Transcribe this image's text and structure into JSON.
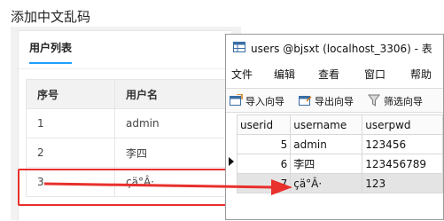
{
  "web": {
    "page_title": "添加中文乱码",
    "tab_label": "用户列表",
    "table": {
      "headers": [
        "序号",
        "用户名"
      ],
      "rows": [
        [
          "1",
          "admin"
        ],
        [
          "2",
          "李四"
        ],
        [
          "3",
          "çä°Â·"
        ]
      ]
    }
  },
  "window": {
    "title": "users @bjsxt (localhost_3306) - 表",
    "menu": [
      "文件",
      "编辑",
      "查看",
      "窗口",
      "帮助"
    ],
    "toolbar": [
      "导入向导",
      "导出向导",
      "筛选向导"
    ],
    "grid": {
      "headers": [
        "userid",
        "username",
        "userpwd"
      ],
      "rows": [
        [
          "5",
          "admin",
          "123456"
        ],
        [
          "6",
          "李四",
          "123456789"
        ],
        [
          "7",
          "çä°Â·",
          "123"
        ]
      ]
    }
  },
  "colors": {
    "accent": "#1e9fff",
    "highlight": "#e8302c"
  }
}
